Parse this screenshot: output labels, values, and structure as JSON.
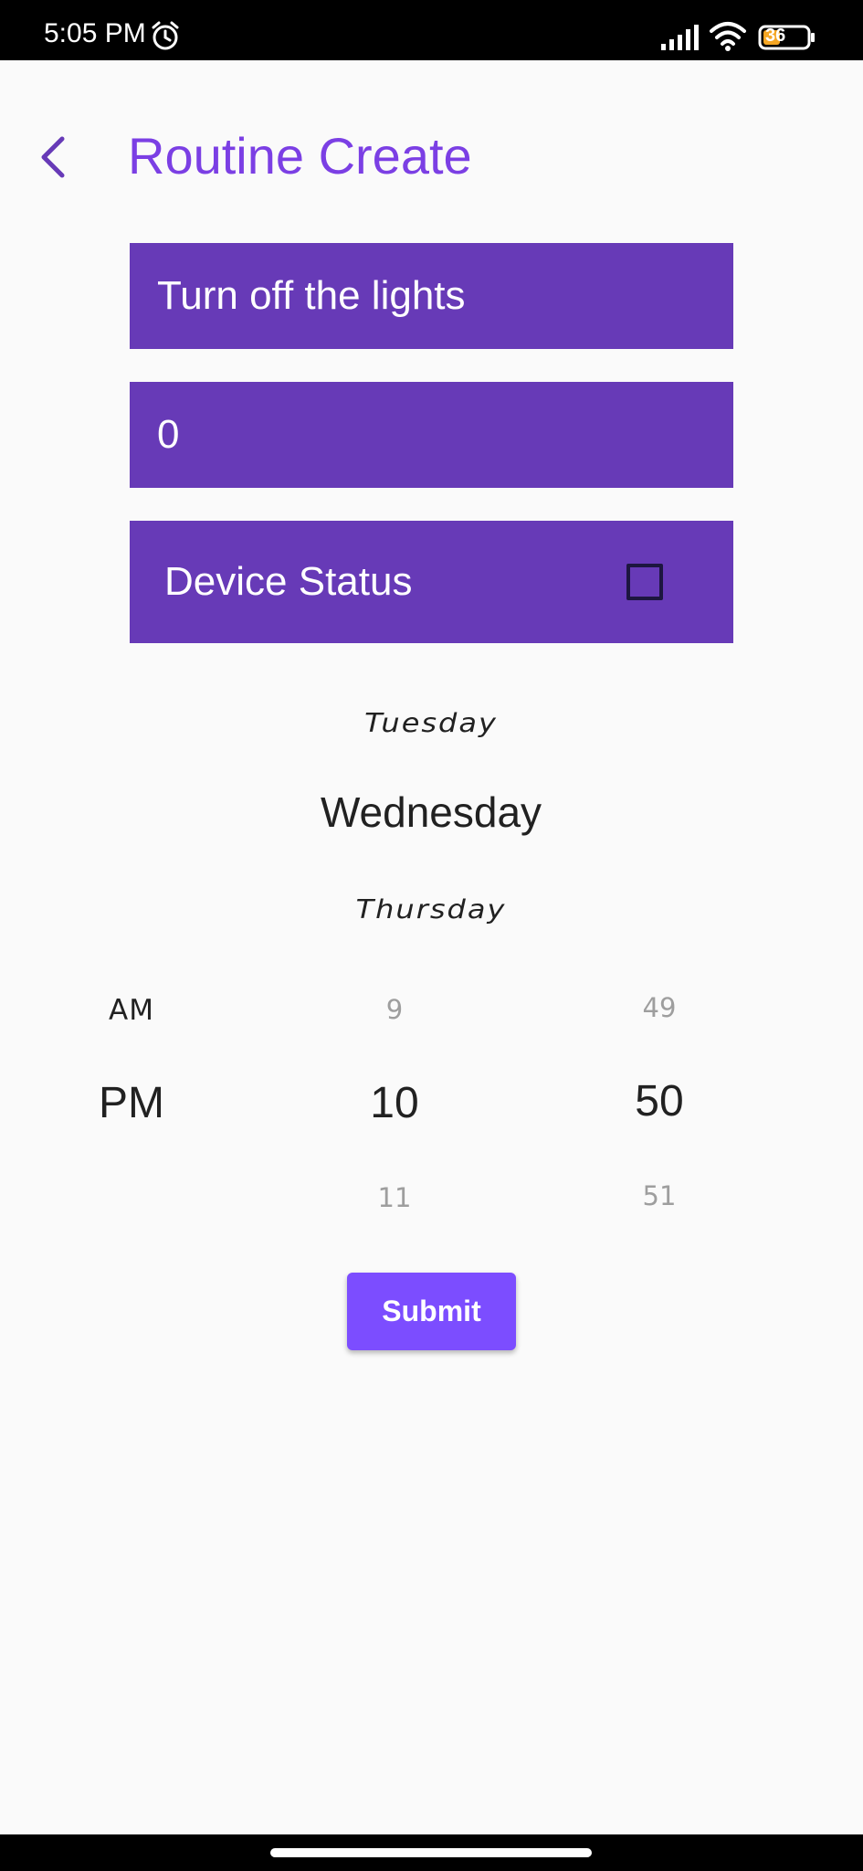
{
  "status_bar": {
    "time": "5:05 PM",
    "battery": "36",
    "icons": [
      "alarm-icon",
      "signal-icon",
      "wifi-icon",
      "battery-icon"
    ]
  },
  "header": {
    "title": "Routine Create",
    "back_icon": "chevron-left-icon"
  },
  "form": {
    "routine_name": "Turn off the lights",
    "routine_value": "0",
    "device_status_label": "Device Status",
    "device_status_checked": false
  },
  "day_picker": {
    "previous": "Tuesday",
    "selected": "Wednesday",
    "next": "Thursday"
  },
  "time_picker": {
    "ampm": {
      "previous": "AM",
      "selected": "PM"
    },
    "hour": {
      "previous": "9",
      "selected": "10",
      "next": "11"
    },
    "minute": {
      "previous": "49",
      "selected": "50",
      "next": "51"
    }
  },
  "submit_label": "Submit",
  "colors": {
    "field_bg": "#673ab7",
    "title": "#7b3fe4",
    "button_bg": "#7c4dff",
    "page_bg": "#fafafa"
  }
}
